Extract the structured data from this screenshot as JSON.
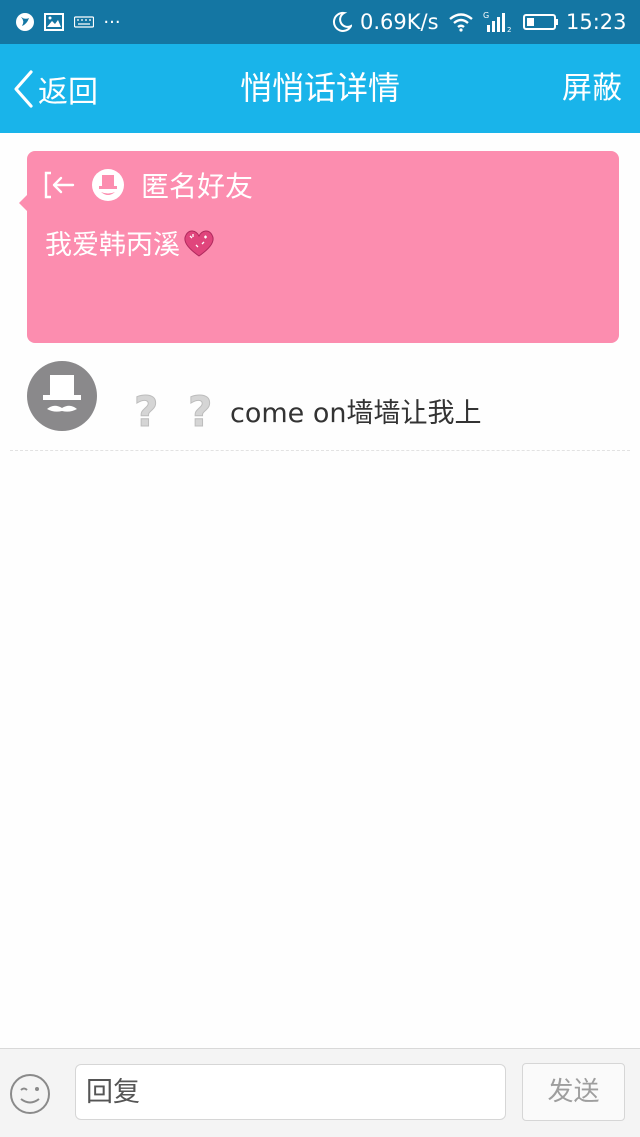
{
  "status_bar": {
    "left_icons": [
      "notification-icon",
      "gallery-icon",
      "keyboard-icon",
      "more-dots-icon"
    ],
    "more_label": "···",
    "right_icons": [
      "moon-icon",
      "wifi-icon",
      "signal-icon",
      "battery-icon"
    ],
    "net_speed": "0.69K/s",
    "time": "15:23"
  },
  "header": {
    "back_label": "返回",
    "title": "悄悄话详情",
    "action_label": "屏蔽"
  },
  "whisper": {
    "sender": "匿名好友",
    "message": "我爱韩丙溪",
    "emoji": "heart-emoji"
  },
  "reply": {
    "text": "come on墙墙让我上",
    "emoji": [
      "question-mark-emoji",
      "question-mark-emoji"
    ]
  },
  "input_bar": {
    "placeholder": "回复",
    "send_label": "发送"
  },
  "colors": {
    "status_bar": "#1476a3",
    "title_bar": "#19b4ea",
    "card": "#fc8daf",
    "avatar": "#8a898b"
  }
}
